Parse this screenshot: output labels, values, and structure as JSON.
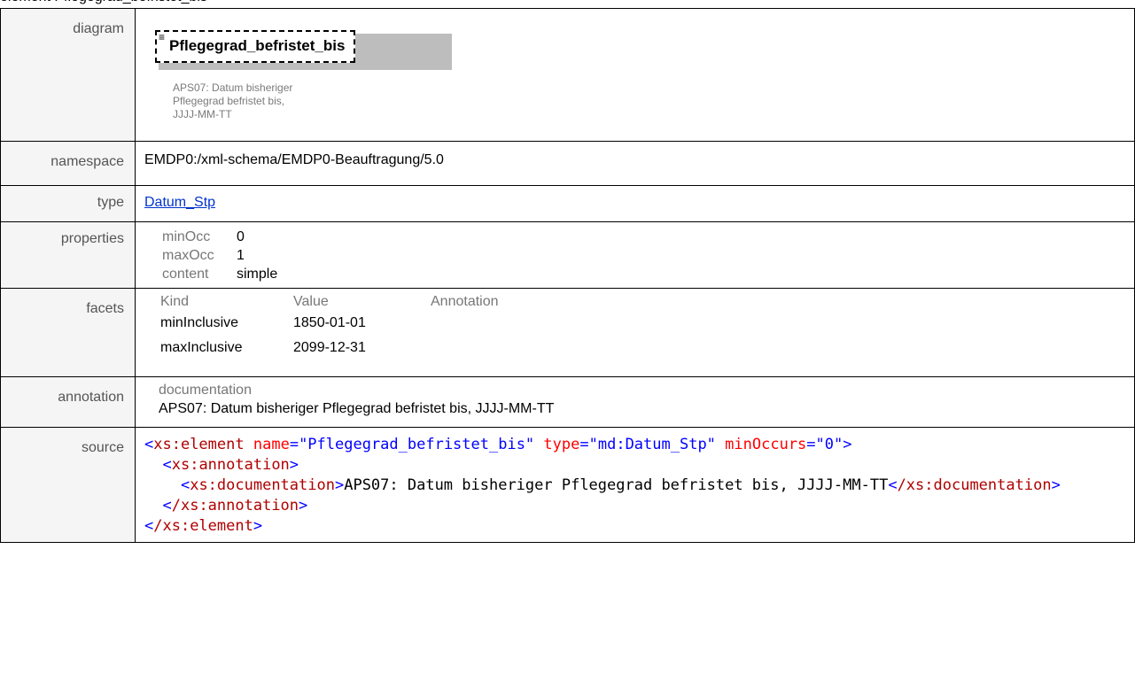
{
  "page_title": "element Pflegegrad_befristet_bis",
  "rows": {
    "diagram": {
      "label": "diagram",
      "element_name": "Pflegegrad_befristet_bis",
      "doc_lines": [
        "APS07: Datum bisheriger",
        "Pflegegrad befristet bis,",
        "JJJJ-MM-TT"
      ]
    },
    "namespace": {
      "label": "namespace",
      "value": "EMDP0:/xml-schema/EMDP0-Beauftragung/5.0"
    },
    "type": {
      "label": "type",
      "value": "Datum_Stp"
    },
    "properties": {
      "label": "properties",
      "items": [
        {
          "key": "minOcc",
          "value": "0"
        },
        {
          "key": "maxOcc",
          "value": "1"
        },
        {
          "key": "content",
          "value": "simple"
        }
      ]
    },
    "facets": {
      "label": "facets",
      "headers": {
        "kind": "Kind",
        "value": "Value",
        "annotation": "Annotation"
      },
      "items": [
        {
          "kind": "minInclusive",
          "value": "1850-01-01",
          "annotation": ""
        },
        {
          "kind": "maxInclusive",
          "value": "2099-12-31",
          "annotation": ""
        }
      ]
    },
    "annotation": {
      "label": "annotation",
      "key": "documentation",
      "value": "APS07: Datum bisheriger Pflegegrad befristet bis, JJJJ-MM-TT"
    },
    "source": {
      "label": "source",
      "open_tag": "xs:element",
      "attr1_name": "name",
      "attr1_value": "\"Pflegegrad_befristet_bis\"",
      "attr2_name": "type",
      "attr2_value": "\"md:Datum_Stp\"",
      "attr3_name": "minOccurs",
      "attr3_value": "\"0\"",
      "anno_tag": "xs:annotation",
      "doc_tag": "xs:documentation",
      "doc_text": "APS07: Datum bisheriger Pflegegrad befristet bis, JJJJ-MM-TT",
      "anno_close": "/xs:annotation",
      "elem_close": "/xs:element",
      "doc_close": "/xs:documentation"
    }
  }
}
